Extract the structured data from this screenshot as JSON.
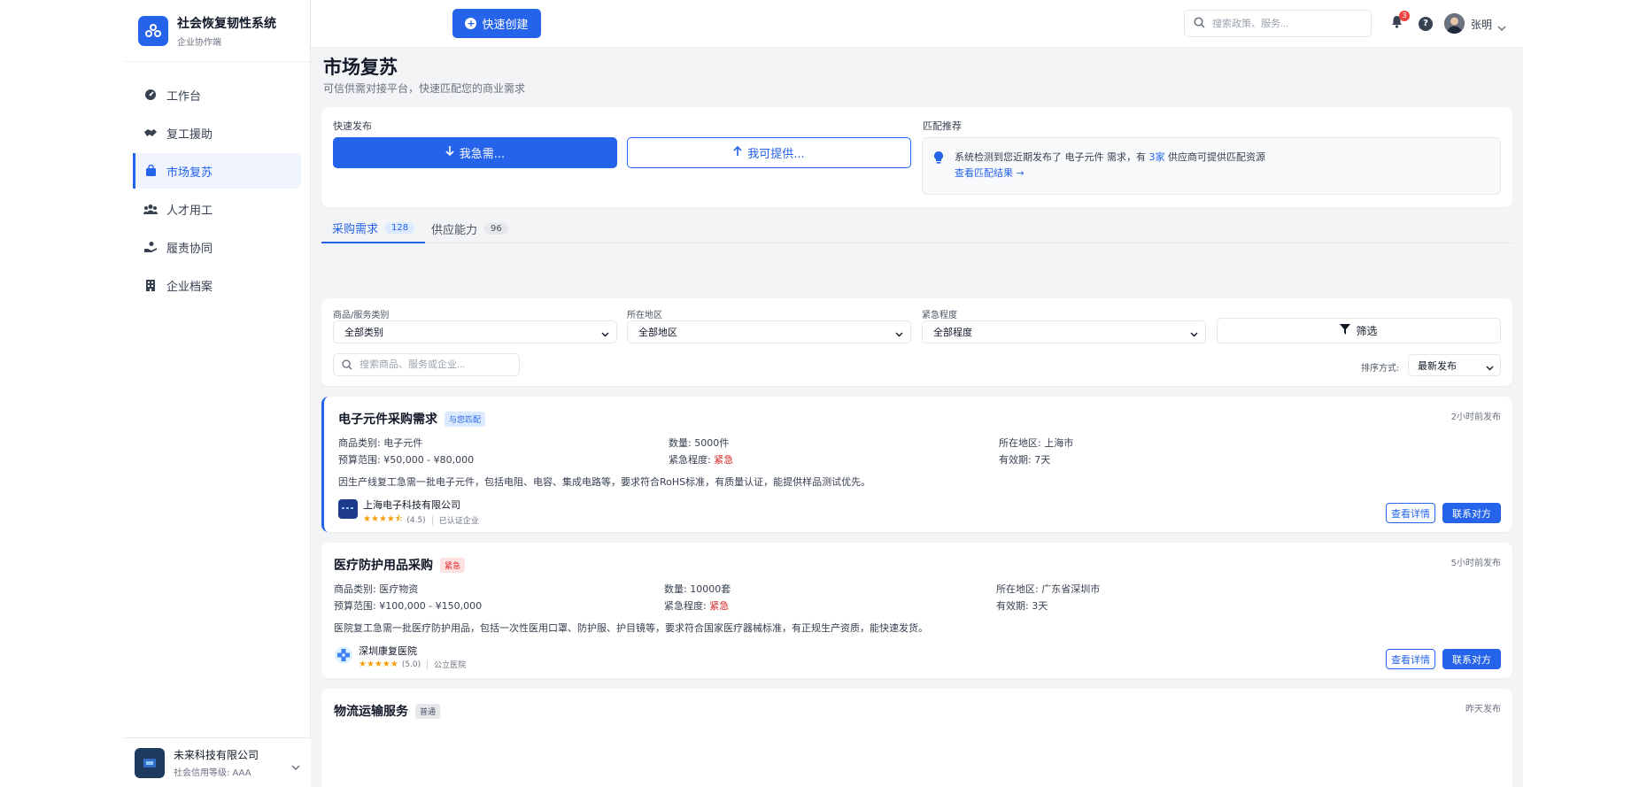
{
  "brand": {
    "title": "社会恢复韧性系统",
    "subtitle": "企业协作端"
  },
  "sidebar": {
    "items": [
      {
        "label": "工作台",
        "icon": "dashboard-icon"
      },
      {
        "label": "复工援助",
        "icon": "handshake-icon"
      },
      {
        "label": "市场复苏",
        "icon": "shopping-bag-icon",
        "active": true
      },
      {
        "label": "人才用工",
        "icon": "users-icon"
      },
      {
        "label": "履责协同",
        "icon": "hand-holding-icon"
      },
      {
        "label": "企业档案",
        "icon": "building-icon"
      }
    ],
    "footer": {
      "company": "未来科技有限公司",
      "level": "社会信用等级: AAA"
    }
  },
  "topbar": {
    "quick_create": "快速创建",
    "search_placeholder": "搜索政策、服务...",
    "notification_count": "3",
    "help": "?",
    "user_name": "张明"
  },
  "page": {
    "title": "市场复苏",
    "subtitle": "可信供需对接平台，快速匹配您的商业需求"
  },
  "quick_publish": {
    "label": "快速发布",
    "need_button": "我急需...",
    "provide_button": "我可提供...",
    "match_label": "匹配推荐",
    "match_text_prefix": "系统检测到您近期发布了 电子元件 需求，有",
    "match_count": "3家",
    "match_text_suffix": "供应商可提供匹配资源",
    "match_link": "查看匹配结果 →"
  },
  "tabs": [
    {
      "label": "采购需求",
      "count": "128",
      "active": true
    },
    {
      "label": "供应能力",
      "count": "96"
    }
  ],
  "filters": {
    "category_label": "商品/服务类别",
    "category_value": "全部类别",
    "region_label": "所在地区",
    "region_value": "全部地区",
    "urgency_label": "紧急程度",
    "urgency_value": "全部程度",
    "filter_button": "筛选",
    "search_placeholder": "搜索商品、服务或企业...",
    "sort_label": "排序方式:",
    "sort_value": "最新发布"
  },
  "requests": [
    {
      "title": "电子元件采购需求",
      "tag": "与您匹配",
      "time": "2小时前发布",
      "category": "商品类别: 电子元件",
      "quantity": "数量: 5000件",
      "region": "所在地区: 上海市",
      "budget": "预算范围: ¥50,000 - ¥80,000",
      "urgency_label": "紧急程度: ",
      "urgency_value": "紧急",
      "validity": "有效期: 7天",
      "description": "因生产线复工急需一批电子元件，包括电阻、电容、集成电路等，要求符合RoHS标准，有质量认证，能提供样品测试优先。",
      "company": "上海电子科技有限公司",
      "stars": "★★★★⯪",
      "rating": "(4.5)",
      "cert": "已认证企业",
      "detail_button": "查看详情",
      "contact_button": "联系对方"
    },
    {
      "title": "医疗防护用品采购",
      "tag": "紧急",
      "time": "5小时前发布",
      "category": "商品类别: 医疗物资",
      "quantity": "数量: 10000套",
      "region": "所在地区: 广东省深圳市",
      "budget": "预算范围: ¥100,000 - ¥150,000",
      "urgency_label": "紧急程度: ",
      "urgency_value": "紧急",
      "validity": "有效期: 3天",
      "description": "医院复工急需一批医疗防护用品，包括一次性医用口罩、防护服、护目镜等，要求符合国家医疗器械标准，有正规生产资质，能快速发货。",
      "company": "深圳康复医院",
      "stars": "★★★★★",
      "rating": "(5.0)",
      "cert": "公立医院",
      "detail_button": "查看详情",
      "contact_button": "联系对方"
    },
    {
      "title": "物流运输服务",
      "tag": "普通",
      "time": "昨天发布"
    }
  ]
}
